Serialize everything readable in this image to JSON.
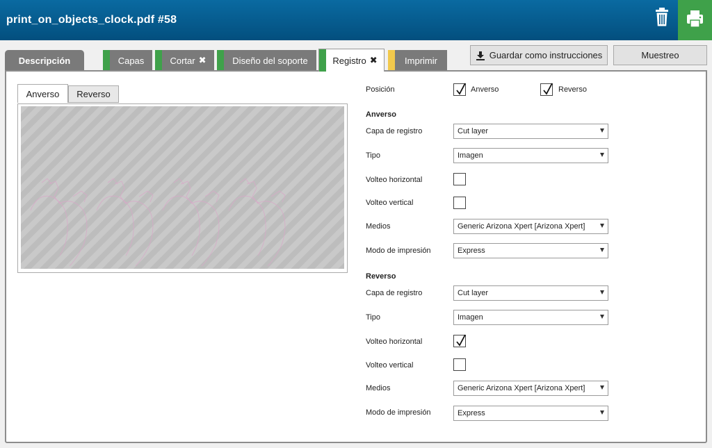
{
  "header": {
    "title": "print_on_objects_clock.pdf #58"
  },
  "tabs": {
    "descripcion": "Descripción",
    "capas": "Capas",
    "cortar": "Cortar",
    "diseno": "Diseño del soporte",
    "registro": "Registro",
    "imprimir": "Imprimir"
  },
  "toolbar": {
    "guardar": "Guardar como instrucciones",
    "muestreo": "Muestreo"
  },
  "preview": {
    "tab_anverso": "Anverso",
    "tab_reverso": "Reverso"
  },
  "form": {
    "posicion_label": "Posición",
    "posicion_anverso": "Anverso",
    "posicion_reverso": "Reverso",
    "anverso": {
      "heading": "Anverso",
      "capa_label": "Capa de registro",
      "capa_value": "Cut layer",
      "tipo_label": "Tipo",
      "tipo_value": "Imagen",
      "volteo_h_label": "Volteo horizontal",
      "volteo_v_label": "Volteo vertical",
      "medios_label": "Medios",
      "medios_value": "Generic Arizona Xpert [Arizona Xpert]",
      "modo_label": "Modo de impresión",
      "modo_value": "Express"
    },
    "reverso": {
      "heading": "Reverso",
      "capa_label": "Capa de registro",
      "capa_value": "Cut layer",
      "tipo_label": "Tipo",
      "tipo_value": "Imagen",
      "volteo_h_label": "Volteo horizontal",
      "volteo_v_label": "Volteo vertical",
      "medios_label": "Medios",
      "medios_value": "Generic Arizona Xpert [Arizona Xpert]",
      "modo_label": "Modo de impresión",
      "modo_value": "Express"
    }
  },
  "colors": {
    "header": "#034f7e",
    "accent_green": "#3fa14a",
    "accent_yellow": "#f2c94c",
    "tab_gray": "#7a7a7a"
  },
  "icons": {
    "trash": "trash-icon",
    "print": "printer-icon",
    "download": "download-icon",
    "close": "close-icon",
    "check": "check-icon"
  }
}
